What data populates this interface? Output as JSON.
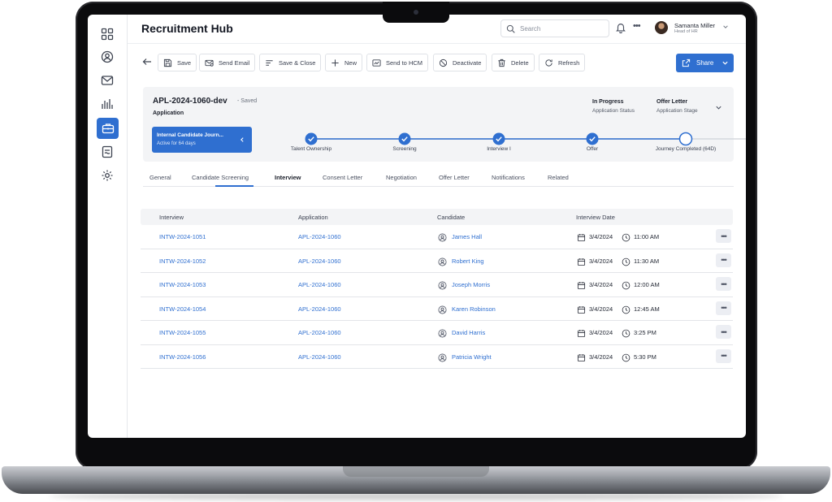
{
  "header": {
    "app_title": "Recruitment Hub",
    "search_placeholder": "Search",
    "user_name": "Samanta Miller",
    "user_role": "Head of HR"
  },
  "toolbar": {
    "save": "Save",
    "send_email": "Send Email",
    "save_close": "Save & Close",
    "new": "New",
    "send_to_hcm": "Send to HCM",
    "deactivate": "Deactivate",
    "delete": "Delete",
    "refresh": "Refresh",
    "share": "Share"
  },
  "record": {
    "id": "APL-2024-1060-dev",
    "saved_state": "- Saved",
    "type": "Application",
    "status_value": "In Progress",
    "status_label": "Application Status",
    "stage_value": "Offer Letter",
    "stage_label": "Application Stage",
    "journey_title": "Internal Candidate Journ...",
    "journey_sub": "Active for 64 days",
    "steps": [
      {
        "label": "Talent Ownership",
        "done": true
      },
      {
        "label": "Screening",
        "done": true
      },
      {
        "label": "Interview I",
        "done": true
      },
      {
        "label": "Offer",
        "done": true
      },
      {
        "label": "Journey Completed (64D)",
        "done": false
      }
    ]
  },
  "tabs": [
    "General",
    "Candidate Screening",
    "Interview",
    "Consent Letter",
    "Negotiation",
    "Offer Letter",
    "Notifications",
    "Related"
  ],
  "active_tab": "Interview",
  "table": {
    "headers": [
      "Interview",
      "Application",
      "Candidate",
      "Interview Date"
    ],
    "rows": [
      {
        "interview": "INTW-2024-1051",
        "application": "APL-2024-1060",
        "candidate": "James Hall",
        "date": "3/4/2024",
        "time": "11:00 AM"
      },
      {
        "interview": "INTW-2024-1052",
        "application": "APL-2024-1060",
        "candidate": "Robert King",
        "date": "3/4/2024",
        "time": "11:30 AM"
      },
      {
        "interview": "INTW-2024-1053",
        "application": "APL-2024-1060",
        "candidate": "Joseph Morris",
        "date": "3/4/2024",
        "time": "12:00 AM"
      },
      {
        "interview": "INTW-2024-1054",
        "application": "APL-2024-1060",
        "candidate": "Karen Robinson",
        "date": "3/4/2024",
        "time": "12:45 AM"
      },
      {
        "interview": "INTW-2024-1055",
        "application": "APL-2024-1060",
        "candidate": "David Harris",
        "date": "3/4/2024",
        "time": "3:25 PM"
      },
      {
        "interview": "INTW-2024-1056",
        "application": "APL-2024-1060",
        "candidate": "Patricia Wright",
        "date": "3/4/2024",
        "time": "5:30 PM"
      }
    ]
  },
  "colors": {
    "accent": "#2f6fd0",
    "card_bg": "#f3f4f6"
  }
}
